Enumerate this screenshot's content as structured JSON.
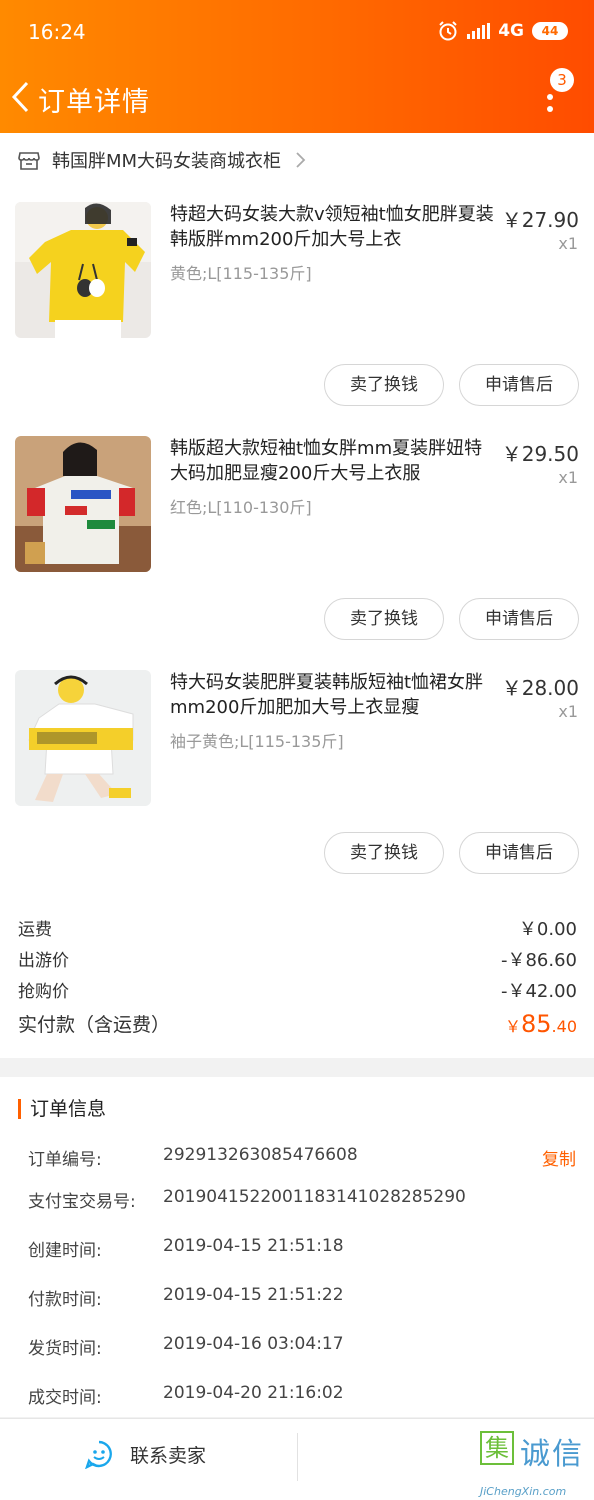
{
  "status_bar": {
    "time": "16:24",
    "network": "4G",
    "battery": "44"
  },
  "nav": {
    "title": "订单详情",
    "badge_count": "3"
  },
  "shop": {
    "name": "韩国胖MM大码女装商城衣柜"
  },
  "items": [
    {
      "title": "特超大码女装大款v领短袖t恤女肥胖夏装韩版胖mm200斤加大号上衣",
      "spec": "黄色;L[115-135斤]",
      "price": "￥27.90",
      "qty": "x1",
      "btn_sell": "卖了换钱",
      "btn_after": "申请售后"
    },
    {
      "title": "韩版超大款短袖t恤女胖mm夏装胖妞特大码加肥显瘦200斤大号上衣服",
      "spec": "红色;L[110-130斤]",
      "price": "￥29.50",
      "qty": "x1",
      "btn_sell": "卖了换钱",
      "btn_after": "申请售后"
    },
    {
      "title": "特大码女装肥胖夏装韩版短袖t恤裙女胖mm200斤加肥加大号上衣显瘦",
      "spec": "袖子黄色;L[115-135斤]",
      "price": "￥28.00",
      "qty": "x1",
      "btn_sell": "卖了换钱",
      "btn_after": "申请售后"
    }
  ],
  "totals": {
    "shipping_label": "运费",
    "shipping_value": "￥0.00",
    "travel_label": "出游价",
    "travel_value": "-￥86.60",
    "flash_label": "抢购价",
    "flash_value": "-￥42.00",
    "paid_label": "实付款（含运费）",
    "paid_currency": "￥",
    "paid_int": "85",
    "paid_dec": ".40"
  },
  "order_info": {
    "title": "订单信息",
    "copy_label": "复制",
    "rows": [
      {
        "label": "订单编号:",
        "value": "292913263085476608"
      },
      {
        "label": "支付宝交易号:",
        "value": "2019041522001183141028285290"
      },
      {
        "label": "创建时间:",
        "value": "2019-04-15 21:51:18"
      },
      {
        "label": "付款时间:",
        "value": "2019-04-15 21:51:22"
      },
      {
        "label": "发货时间:",
        "value": "2019-04-16 03:04:17"
      },
      {
        "label": "成交时间:",
        "value": "2019-04-20 21:16:02"
      }
    ]
  },
  "bottom": {
    "contact_label": "联系卖家"
  },
  "watermark": {
    "box_char": "集",
    "chars": "诚信",
    "url": "JiChengXin.com"
  },
  "colors": {
    "accent": "#ff6a00",
    "price_highlight": "#ff5500",
    "header_from": "#ff8a00",
    "header_to": "#ff4c00"
  }
}
